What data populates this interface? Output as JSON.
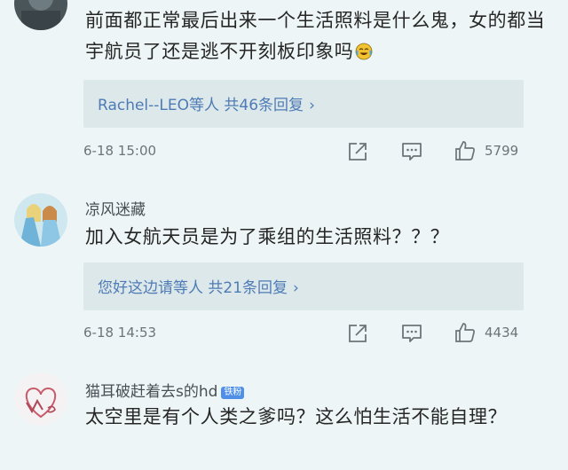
{
  "comments": [
    {
      "username": "",
      "badge": "",
      "text": "前面都正常最后出来一个生活照料是什么鬼，女的都当宇航员了还是逃不开刻板印象吗",
      "emoji": "crying-laughing-emoji",
      "reply_summary": "Rachel--LEO等人 共46条回复",
      "time": "6-18 15:00",
      "likes": "5799"
    },
    {
      "username": "凉风迷藏",
      "badge": "",
      "text": "加入女航天员是为了乘组的生活照料？？？",
      "reply_summary": "您好这边请等人 共21条回复",
      "time": "6-18 14:53",
      "likes": "4434"
    },
    {
      "username": "猫耳破赶着去s的hd",
      "badge": "铁粉",
      "text": "太空里是有个人类之爹吗？这么怕生活不能自理？"
    }
  ],
  "reply_chevron": "›",
  "icons": {
    "share": "share-icon",
    "comment": "comment-icon",
    "like": "thumbs-up-icon"
  },
  "colors": {
    "background": "#edf5f6",
    "reply_link": "#4e7bb5",
    "meta": "#6d7479",
    "badge": "#4f8fe8"
  }
}
